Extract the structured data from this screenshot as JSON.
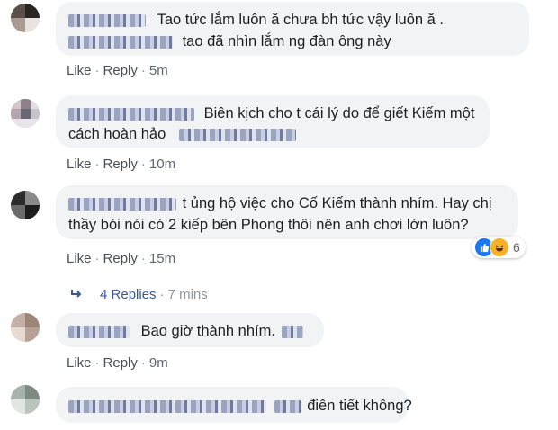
{
  "comments": [
    {
      "lines": [
        "Tao tức lắm luôn ă chưa bh tức vậy luôn ă .",
        "tao đã nhìn lắm ng đàn ông này"
      ],
      "time": "5m"
    },
    {
      "lines": [
        "Biên kịch cho t cái lý do để giết Kiếm một",
        "cách hoàn hảo"
      ],
      "time": "10m"
    },
    {
      "lines": [
        "t ủng hộ việc cho Cố Kiếm thành nhím. Hay chị",
        "thầy bói nói có 2 kiếp bên Phong thôi nên anh chơi lớn luôn?"
      ],
      "time": "15m",
      "reactions": {
        "count": "6",
        "icons": [
          "like-icon",
          "haha-icon"
        ],
        "colors": [
          "#1877f2",
          "#f7b125"
        ]
      }
    },
    {
      "lines": [
        "Bao giờ thành nhím."
      ],
      "time": "9m"
    },
    {
      "lines": [
        "điên tiết không?"
      ],
      "time": ""
    }
  ],
  "actions": {
    "like": "Like",
    "reply": "Reply",
    "separator": "·"
  },
  "replies": {
    "label": "4 Replies",
    "time": "7 mins",
    "icon": "reply-arrow-icon"
  },
  "colors": {
    "link": "#365899",
    "bubble": "#f2f3f5",
    "meta": "#606770"
  }
}
